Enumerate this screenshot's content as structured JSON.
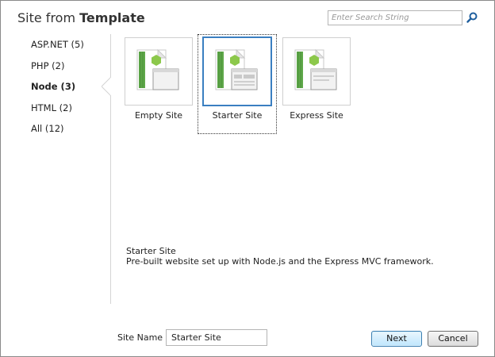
{
  "header": {
    "title_prefix": "Site from",
    "title_emphasis": "Template",
    "search_placeholder": "Enter Search String"
  },
  "sidebar": {
    "items": [
      {
        "label": "ASP.NET (5)",
        "selected": false
      },
      {
        "label": "PHP (2)",
        "selected": false
      },
      {
        "label": "Node (3)",
        "selected": true
      },
      {
        "label": "HTML (2)",
        "selected": false
      },
      {
        "label": "All (12)",
        "selected": false
      }
    ]
  },
  "templates": {
    "items": [
      {
        "label": "Empty Site",
        "icon": "node-empty-site-icon",
        "selected": false
      },
      {
        "label": "Starter Site",
        "icon": "node-starter-site-icon",
        "selected": true
      },
      {
        "label": "Express Site",
        "icon": "node-express-site-icon",
        "selected": false
      }
    ]
  },
  "description": {
    "title": "Starter Site",
    "text": "Pre-built website set up with Node.js and the Express MVC framework."
  },
  "footer": {
    "site_name_label": "Site Name",
    "site_name_value": "Starter Site",
    "next_label": "Next",
    "cancel_label": "Cancel"
  },
  "colors": {
    "accent": "#3a7fc1",
    "node_green": "#8cc84b",
    "sheet_green": "#5fa84a"
  }
}
